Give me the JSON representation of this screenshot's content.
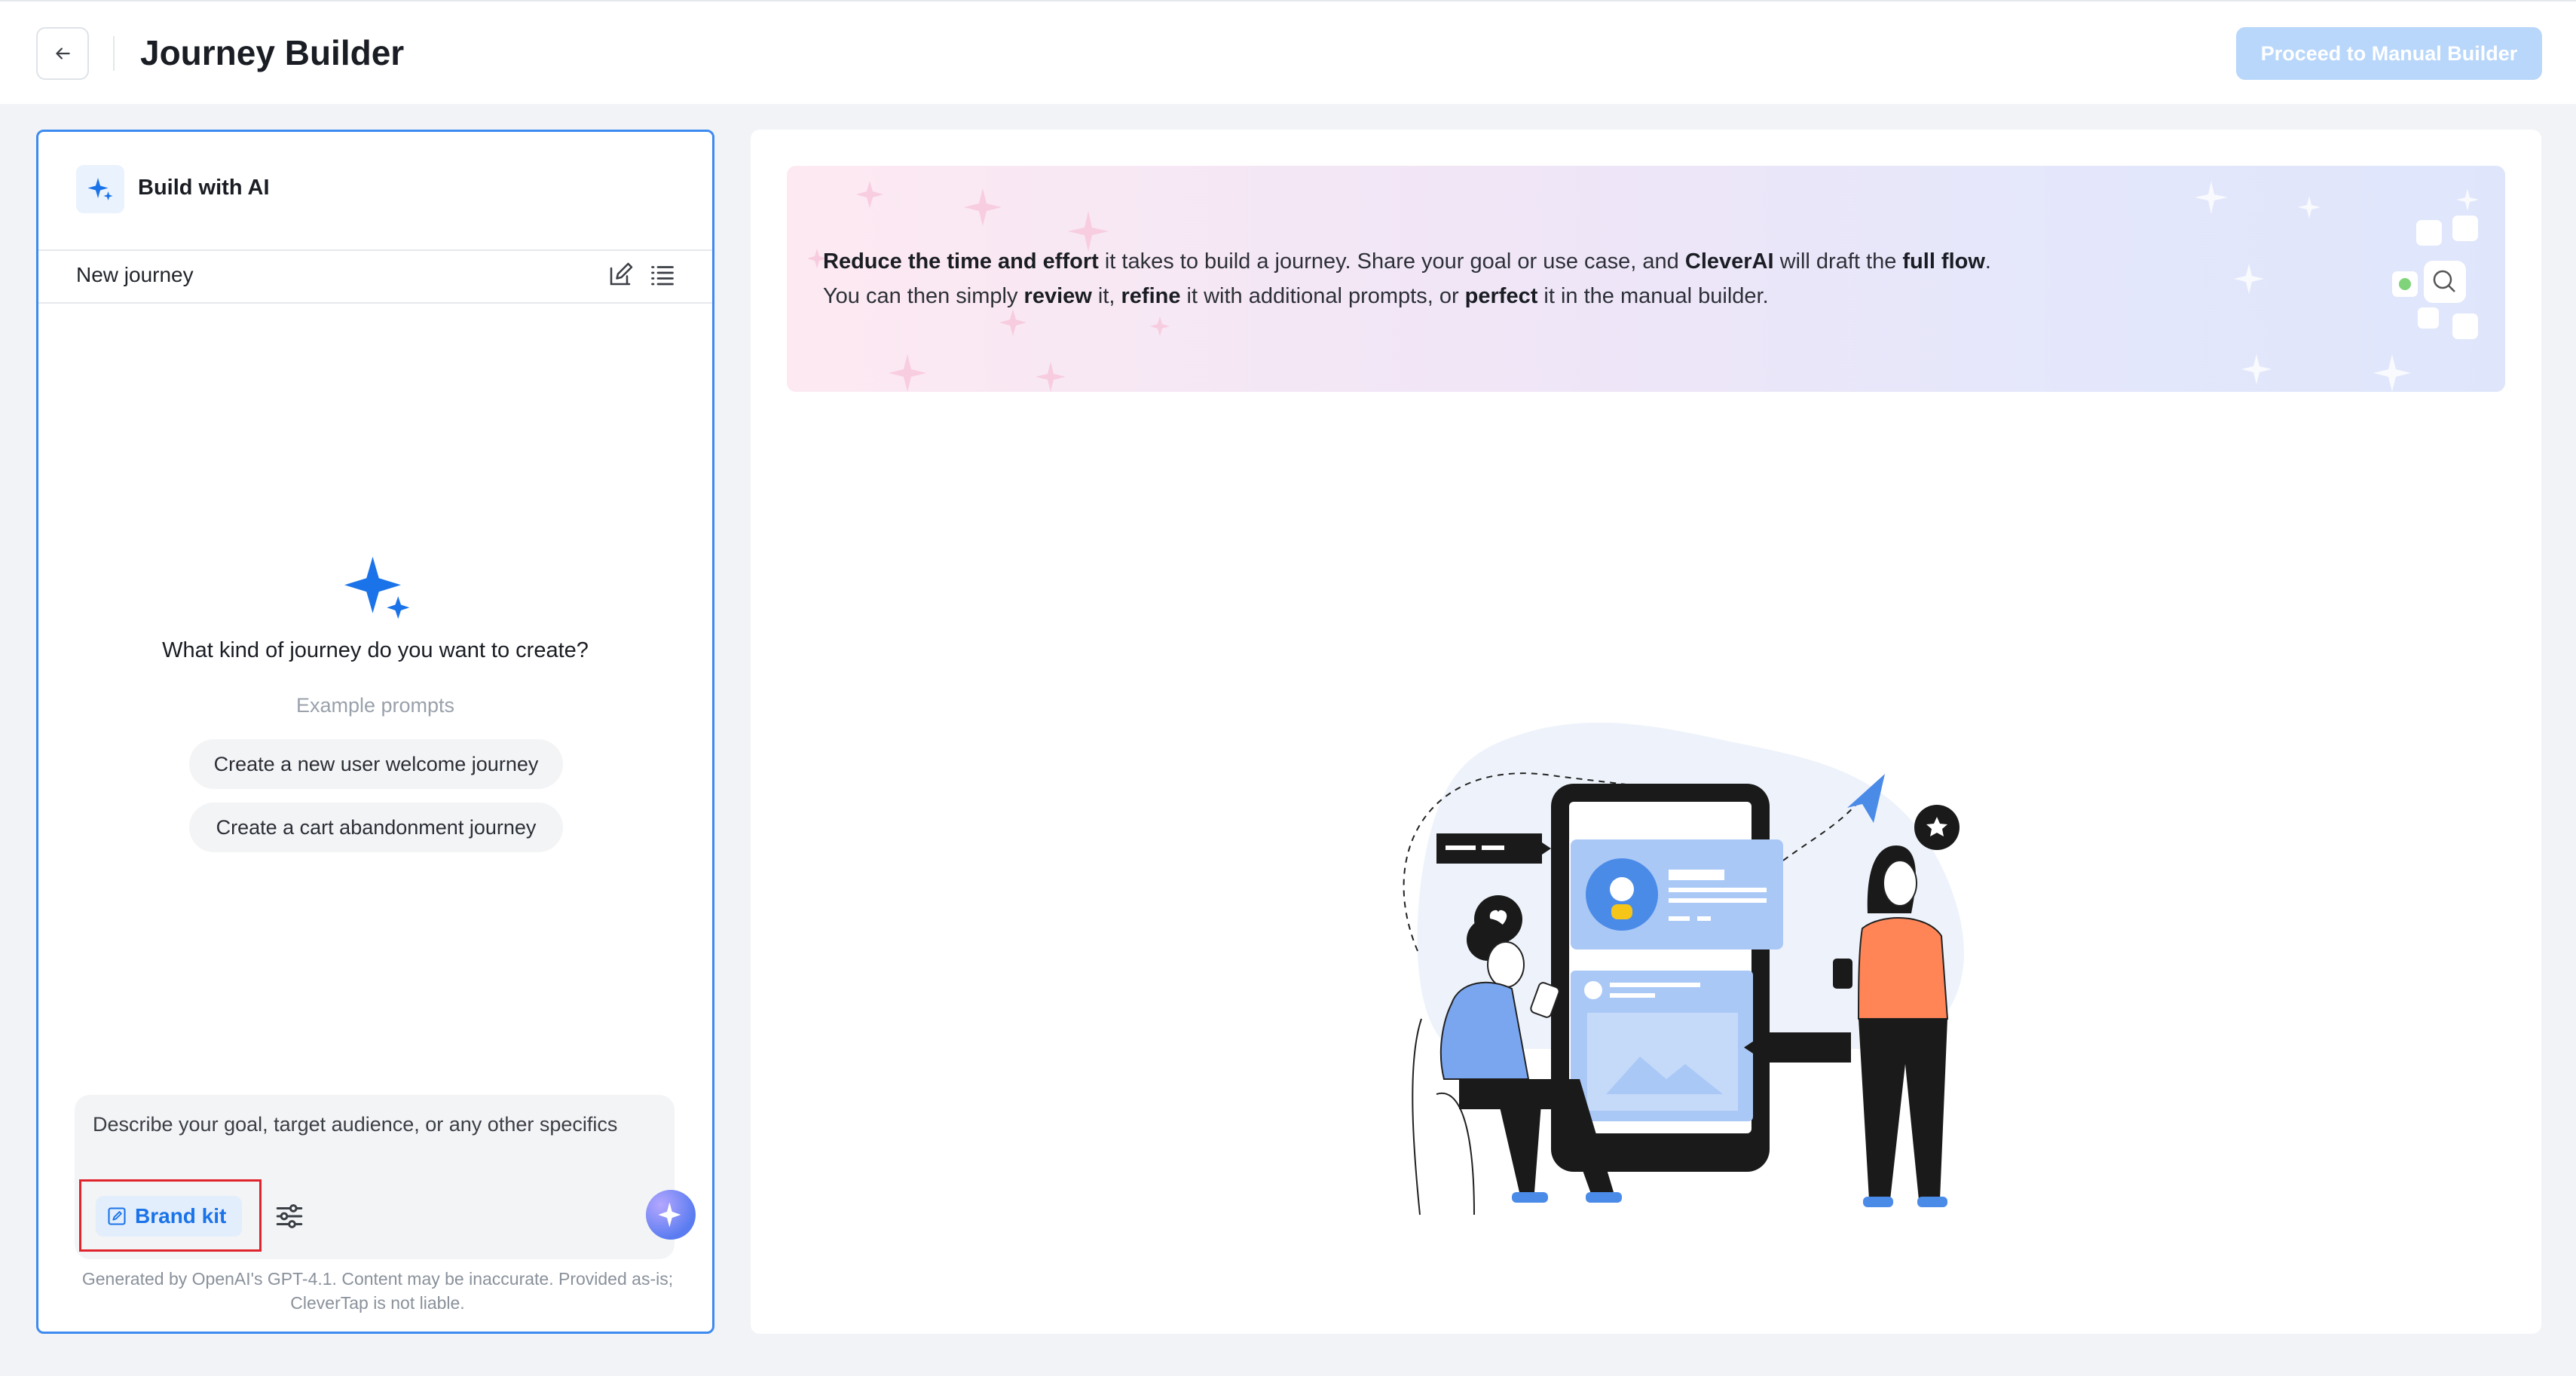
{
  "header": {
    "title": "Journey Builder",
    "proceed_label": "Proceed to Manual Builder"
  },
  "left_panel": {
    "build_with_ai_label": "Build with AI",
    "journey_name": "New journey",
    "question": "What kind of journey do you want to create?",
    "example_label": "Example prompts",
    "example_prompts": [
      "Create a new user welcome journey",
      "Create a cart abandonment journey"
    ],
    "input_placeholder": "Describe your goal, target audience, or any other specifics",
    "brand_kit_label": "Brand kit",
    "disclaimer": "Generated by OpenAI's GPT-4.1. Content may be inaccurate. Provided as-is; CleverTap is not liable."
  },
  "banner": {
    "line1": [
      {
        "t": "Reduce the time and effort",
        "b": true
      },
      {
        "t": " it takes to build a journey. Share your goal or use case, and ",
        "b": false
      },
      {
        "t": "CleverAI",
        "b": true
      },
      {
        "t": " will draft the ",
        "b": false
      },
      {
        "t": "full flow",
        "b": true
      },
      {
        "t": ".",
        "b": false
      }
    ],
    "line2": [
      {
        "t": "You can then simply ",
        "b": false
      },
      {
        "t": "review",
        "b": true
      },
      {
        "t": " it, ",
        "b": false
      },
      {
        "t": "refine",
        "b": true
      },
      {
        "t": " it with additional prompts, or ",
        "b": false
      },
      {
        "t": "perfect",
        "b": true
      },
      {
        "t": " it in the manual builder.",
        "b": false
      }
    ]
  },
  "colors": {
    "accent": "#1a73e8",
    "panel_border": "#3d8af0",
    "proceed_bg": "#b9d7fb",
    "highlight": "#e0242c"
  },
  "icons": [
    "arrow-left-icon",
    "sparkle-icon",
    "edit-icon",
    "list-icon",
    "brand-kit-icon",
    "sliders-icon",
    "send-sparkle-icon"
  ]
}
